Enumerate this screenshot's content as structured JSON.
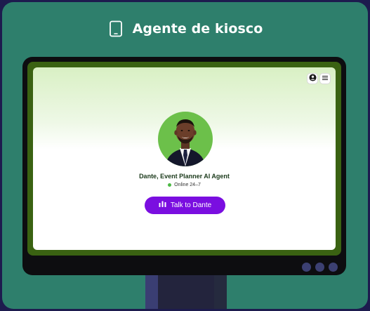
{
  "header": {
    "title": "Agente de kiosco",
    "icon": "tablet-icon"
  },
  "screen": {
    "top_icons": [
      "account-icon",
      "menu-icon"
    ],
    "agent": {
      "name": "Dante, Event Planner AI Agent",
      "status": "Online 24–7",
      "status_color": "#4cb944"
    },
    "cta": {
      "label": "Talk to Dante",
      "icon": "audio-bars-icon",
      "color": "#7a0ee0"
    }
  },
  "colors": {
    "page_background": "#1d1b4e",
    "card_background": "#2e7f6c",
    "bezel": "#3a6212",
    "avatar_background": "#6cc04a"
  }
}
